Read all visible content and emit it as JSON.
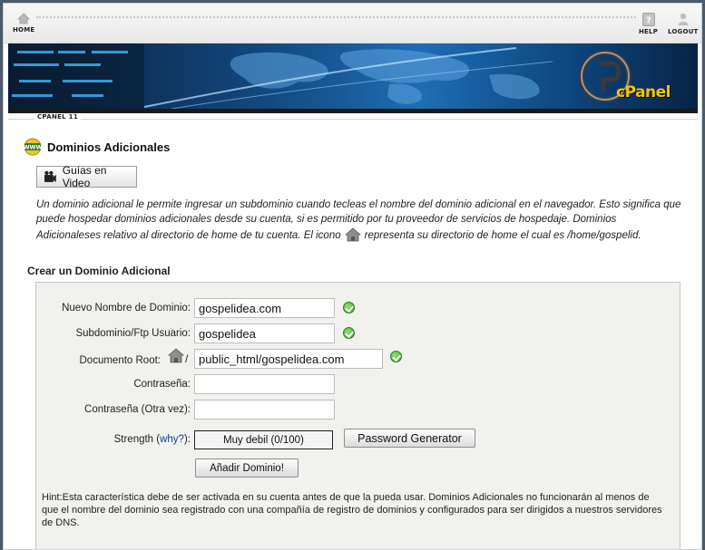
{
  "topnav": {
    "home_label": "HOME",
    "help_label": "HELP",
    "logout_label": "LOGOUT"
  },
  "banner": {
    "logo_text": "cPanel"
  },
  "breadcrumb": {
    "label": "CPANEL 11"
  },
  "page": {
    "title": "Dominios Adicionales",
    "video_button_label": "Guías en Video",
    "intro_part1": "Un dominio adicional le permite ingresar un subdominio cuando tecleas el nombre del dominio adicional en el navegador. Esto significa que puede hospedar dominios adicionales desde su cuenta, si es permitido por tu proveedor de servicios de hospedaje. Dominios Adicionaleses relativo al directorio de home de tu cuenta. El icono",
    "intro_part2": "representa su directorio de home el cual es /home/gospelid.",
    "section_title": "Crear un Dominio Adicional"
  },
  "form": {
    "domain_label": "Nuevo Nombre de Dominio:",
    "domain_value": "gospelidea.com",
    "subdomain_label": "Subdominio/Ftp Usuario:",
    "subdomain_value": "gospelidea",
    "docroot_label": "Documento Root:",
    "docroot_separator": "/",
    "docroot_value": "public_html/gospelidea.com",
    "password_label": "Contraseña:",
    "password_value": "",
    "password2_label": "Contraseña (Otra vez):",
    "password2_value": "",
    "strength_label_prefix": "Strength (",
    "strength_link": "why?",
    "strength_label_suffix": "):",
    "strength_value": "Muy debil (0/100)",
    "password_generator_label": "Password Generator",
    "submit_label": "Añadir Dominio!",
    "hint": "Hint:Esta característica debe de ser activada en su cuenta antes de que la pueda usar. Dominios Adicionales no funcionarán al menos de que el nombre del dominio sea registrado con una compañía de registro de dominios y configurados para ser dirigidos a nuestros servidores de DNS."
  },
  "colors": {
    "link": "#1a3d9e",
    "valid_check": "#3a9e2a",
    "panel_bg": "#f1f2ee"
  }
}
